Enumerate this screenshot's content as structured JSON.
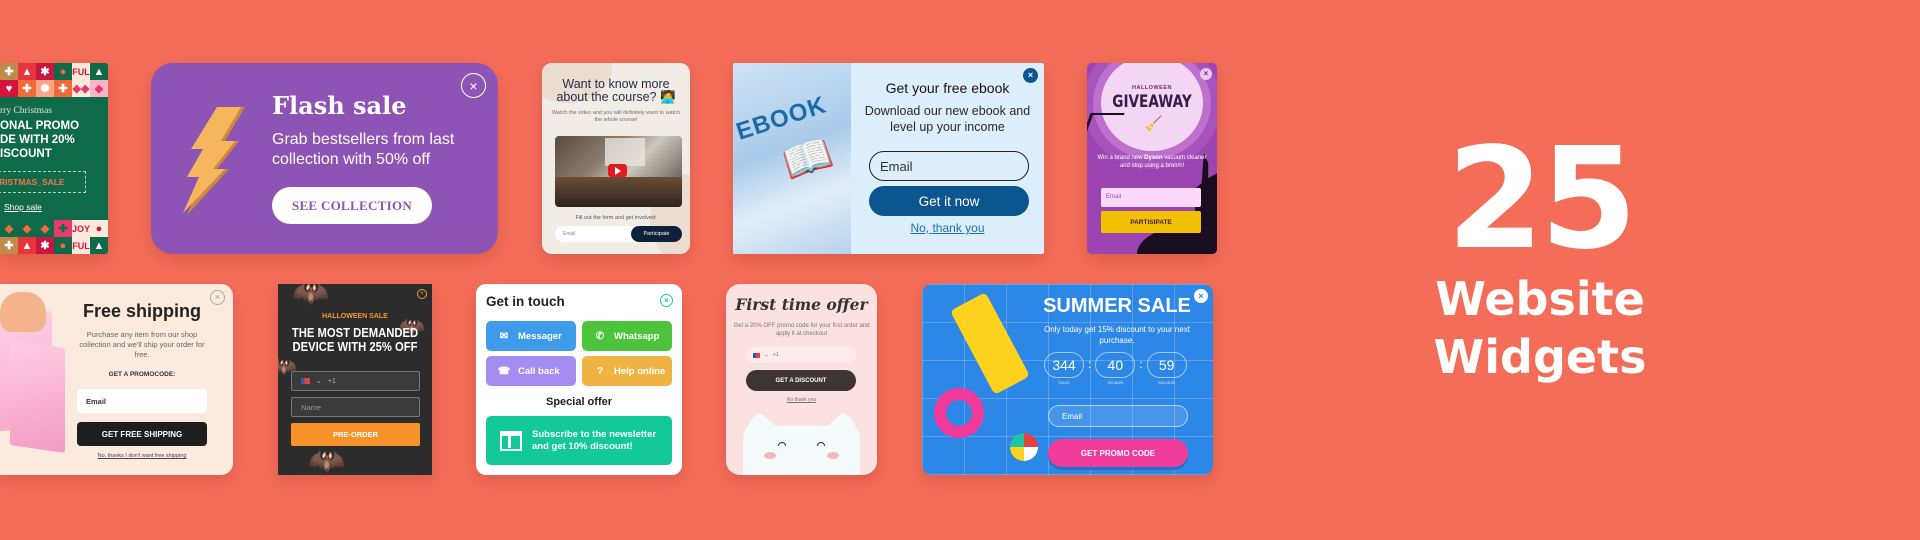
{
  "headline": {
    "number": "25",
    "line1": "Website",
    "line2": "Widgets"
  },
  "colors": {
    "background": "#f36d58",
    "flash_purple": "#8d54b5",
    "ebook_blue": "#0b568f",
    "giveaway_yellow": "#f2c200",
    "preorder_orange": "#f7922b",
    "touch_green": "#13c99a",
    "summer_blue": "#2d87e6",
    "summer_pink": "#f03c9a"
  },
  "widgets": {
    "christmas": {
      "top_tiles": [
        "✚",
        "▲",
        "✱",
        "●",
        "FUL",
        "▲"
      ],
      "bottom_tiles": [
        "◆",
        "◆",
        "◆",
        "✚",
        "JOY",
        "●"
      ],
      "greeting": "rry Christmas",
      "promo_lines": [
        "ONAL PROMO",
        "DE WITH 20%",
        "ISCOUNT"
      ],
      "code": "RISTMAS_SALE",
      "link": "Shop sale"
    },
    "flash_sale": {
      "title": "Flash sale",
      "text": "Grab bestsellers from last collection with 50% off",
      "cta": "SEE COLLECTION",
      "close": "×"
    },
    "course": {
      "title": "Want to know more about the course? 🧑‍💻",
      "subtitle": "Watch the video and you will definitely want to watch the whole course!",
      "form_label": "Fill out the form and get involved:",
      "email_placeholder": "Email",
      "button": "Participate"
    },
    "ebook": {
      "image_word": "EBOOK",
      "title": "Get your free ebook",
      "subtitle": "Download our new ebook and level up your income",
      "email_placeholder": "Email",
      "button": "Get it now",
      "decline": "No, thank you",
      "close": "×"
    },
    "giveaway": {
      "kicker": "HALLOWEEN",
      "title": "GIVEAWAY",
      "text_before": "Win a brand new ",
      "text_bold": "Dyson",
      "text_after": " vacuum cleaner and stop using a broom!",
      "email_placeholder": "Email",
      "button": "PARTISIPATE",
      "close": "×"
    },
    "free_shipping": {
      "title": "Free shipping",
      "subtitle": "Purchase any item from our shop collection and we'll ship your order for free.",
      "promo_label": "GET A PROMOCODE:",
      "email_placeholder": "Email",
      "button": "GET FREE SHIPPING",
      "decline": "No, thanks I don't want free shipping",
      "close": "×"
    },
    "halloween_sale": {
      "label": "HALLOWEEN SALE",
      "title": "THE MOST DEMANDED DEVICE WITH 25% OFF",
      "phone_prefix": "+1",
      "name_placeholder": "Name",
      "button": "PRE-ORDER",
      "close": "×"
    },
    "get_in_touch": {
      "title": "Get in touch",
      "buttons": [
        {
          "label": "Messager",
          "icon": "✉",
          "color": "#3d9be9"
        },
        {
          "label": "Whatsapp",
          "icon": "✆",
          "color": "#4cc53c"
        },
        {
          "label": "Call back",
          "icon": "☎",
          "color": "#a58cf0"
        },
        {
          "label": "Help online",
          "icon": "?",
          "color": "#f0b445"
        }
      ],
      "special_title": "Special offer",
      "offer_text": "Subscribe to the newsletter and get 10% discount!",
      "close": "×"
    },
    "first_time_offer": {
      "title": "First time offer",
      "subtitle": "Get a 20% OFF promo code for your first order and apply it at checkout",
      "phone_prefix": "+1",
      "button": "GET A DISCOUNT",
      "decline": "No thank you"
    },
    "summer_sale": {
      "title": "SUMMER SALE",
      "subtitle": "Only today  get 15% discount to your next purchase.",
      "countdown": [
        {
          "value": "344",
          "label": "hours"
        },
        {
          "value": "40",
          "label": "minutes"
        },
        {
          "value": "59",
          "label": "seconds"
        }
      ],
      "separator": ":",
      "email_placeholder": "Email",
      "button": "GET PROMO CODE",
      "close": "×"
    }
  }
}
